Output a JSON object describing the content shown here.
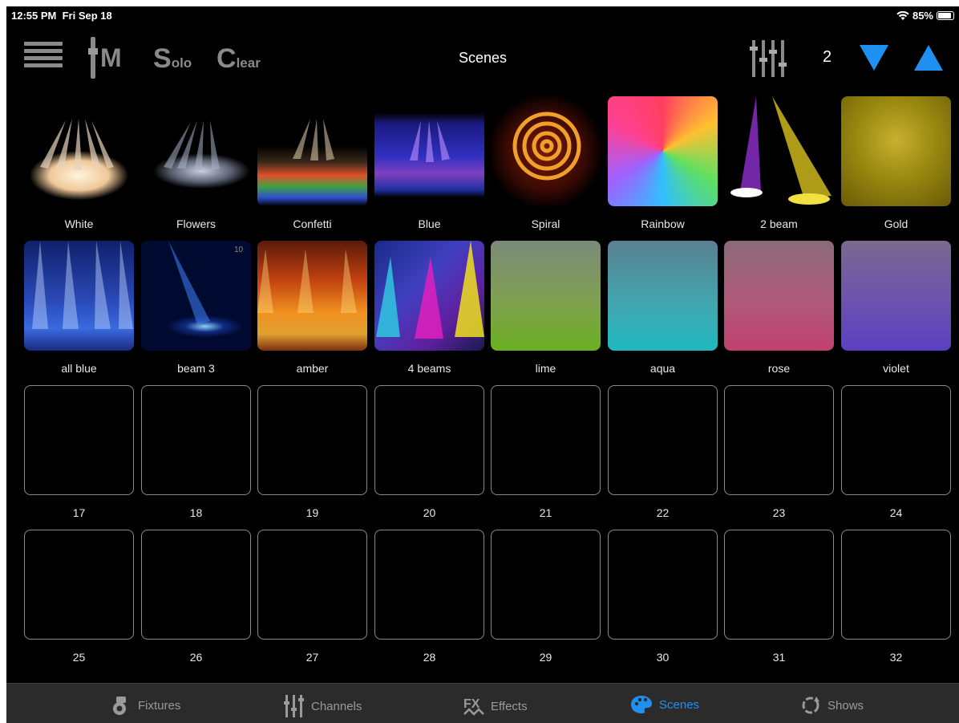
{
  "status": {
    "time": "12:55 PM",
    "date": "Fri Sep 18",
    "battery": "85%"
  },
  "toolbar": {
    "m_label": "M",
    "solo_big": "S",
    "solo_small": "olo",
    "clear_big": "C",
    "clear_small": "lear",
    "title": "Scenes",
    "page": "2"
  },
  "scenes": [
    {
      "label": "White",
      "image": "white spotlights"
    },
    {
      "label": "Flowers",
      "image": "grey light beams"
    },
    {
      "label": "Confetti",
      "image": "multicolor floor lights"
    },
    {
      "label": "Blue",
      "image": "blue beams"
    },
    {
      "label": "Spiral",
      "image": "orange spiral gobo"
    },
    {
      "label": "Rainbow",
      "image": "rainbow swirl pattern"
    },
    {
      "label": "2 beam",
      "image": "purple and yellow beams"
    },
    {
      "label": "Gold",
      "image": "gold starburst"
    },
    {
      "label": "all blue",
      "image": "blue stage beams"
    },
    {
      "label": "beam 3",
      "image": "single blue beam"
    },
    {
      "label": "amber",
      "image": "amber stage lights"
    },
    {
      "label": "4 beams",
      "image": "colored cone beams"
    },
    {
      "label": "lime",
      "image": "lime gradient"
    },
    {
      "label": "aqua",
      "image": "aqua gradient"
    },
    {
      "label": "rose",
      "image": "rose gradient"
    },
    {
      "label": "violet",
      "image": "violet gradient"
    },
    {
      "label": "17"
    },
    {
      "label": "18"
    },
    {
      "label": "19"
    },
    {
      "label": "20"
    },
    {
      "label": "21"
    },
    {
      "label": "22"
    },
    {
      "label": "23"
    },
    {
      "label": "24"
    },
    {
      "label": "25"
    },
    {
      "label": "26"
    },
    {
      "label": "27"
    },
    {
      "label": "28"
    },
    {
      "label": "29"
    },
    {
      "label": "30"
    },
    {
      "label": "31"
    },
    {
      "label": "32"
    }
  ],
  "badge_10": "10",
  "tabs": [
    {
      "label": "Fixtures",
      "icon": "fixture-icon"
    },
    {
      "label": "Channels",
      "icon": "sliders-icon"
    },
    {
      "label": "Effects",
      "icon": "fx-icon"
    },
    {
      "label": "Scenes",
      "icon": "palette-icon",
      "active": true
    },
    {
      "label": "Shows",
      "icon": "cycle-icon"
    }
  ],
  "colors": {
    "accent": "#1f8ff0",
    "inactive": "#9a9a9a"
  }
}
